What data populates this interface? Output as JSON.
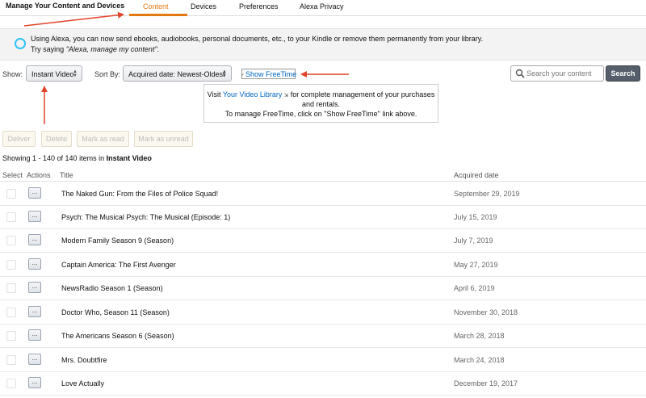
{
  "header": {
    "title": "Manage Your Content and Devices",
    "tabs": [
      {
        "label": "Content",
        "active": true
      },
      {
        "label": "Devices",
        "active": false
      },
      {
        "label": "Preferences",
        "active": false
      },
      {
        "label": "Alexa Privacy",
        "active": false
      }
    ]
  },
  "alexa": {
    "line1": "Using Alexa, you can now send ebooks, audiobooks, personal documents, etc., to your Kindle or remove them permanently from your library.",
    "line2_prefix": "Try saying ",
    "line2_command": "\"Alexa, manage my content\"",
    "line2_suffix": "."
  },
  "filters": {
    "show_label": "Show:",
    "show_value": "Instant Video",
    "sort_label": "Sort By:",
    "sort_value": "Acquired date: Newest-Oldest",
    "freetime_link": "Show FreeTime"
  },
  "search": {
    "placeholder": "Search your content",
    "button": "Search"
  },
  "info": {
    "visit": "Visit ",
    "link": "Your Video Library",
    "after_link": " for complete management of your purchases",
    "line2": "and rentals.",
    "line3": "To manage FreeTime, click on \"Show FreeTime\" link above."
  },
  "actions": {
    "deliver": "Deliver",
    "delete": "Delete",
    "mark_read": "Mark as read",
    "mark_unread": "Mark as unread"
  },
  "summary": {
    "prefix": "Showing 1 - 140 of 140 items in ",
    "category": "Instant Video"
  },
  "table": {
    "headers": {
      "select": "Select",
      "actions": "Actions",
      "title": "Title",
      "date": "Acquired date"
    },
    "action_glyph": "...",
    "rows": [
      {
        "title": "The Naked Gun: From the Files of Police Squad!",
        "date": "September 29, 2019"
      },
      {
        "title": "Psych: The Musical Psych: The Musical (Episode: 1)",
        "date": "July 15, 2019"
      },
      {
        "title": "Modern Family Season 9 (Season)",
        "date": "July 7, 2019"
      },
      {
        "title": "Captain America: The First Avenger",
        "date": "May 27, 2019"
      },
      {
        "title": "NewsRadio Season 1 (Season)",
        "date": "April 6, 2019"
      },
      {
        "title": "Doctor Who, Season 11 (Season)",
        "date": "November 30, 2018"
      },
      {
        "title": "The Americans Season 6 (Season)",
        "date": "March 28, 2018"
      },
      {
        "title": "Mrs. Doubtfire",
        "date": "March 24, 2018"
      },
      {
        "title": "Love Actually",
        "date": "December 19, 2017"
      }
    ]
  },
  "colors": {
    "accent": "#e47911",
    "alexa": "#31c4f3",
    "link": "#0066c0",
    "annotation": "#e0442a"
  }
}
